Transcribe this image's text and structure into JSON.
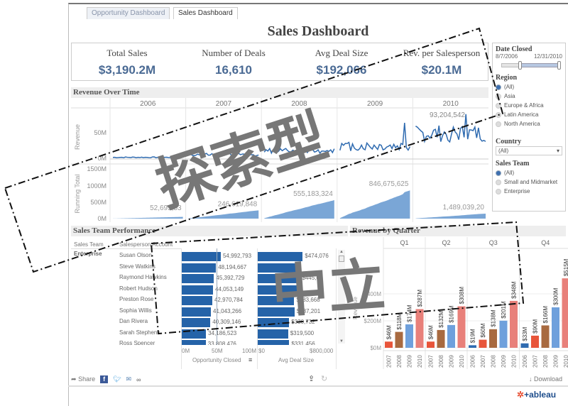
{
  "tabs": [
    {
      "label": "Opportunity Dashboard",
      "active": false
    },
    {
      "label": "Sales Dashboard",
      "active": true
    }
  ],
  "title": "Sales Dashboard",
  "kpis": [
    {
      "label": "Total Sales",
      "value": "$3,190.2M"
    },
    {
      "label": "Number of Deals",
      "value": "16,610"
    },
    {
      "label": "Avg Deal Size",
      "value": "$192,066"
    },
    {
      "label": "Rev. per Salesperson",
      "value": "$20.1M"
    }
  ],
  "filters": {
    "date_closed": {
      "label": "Date Closed",
      "start": "8/7/2006",
      "end": "12/31/2010"
    },
    "region": {
      "label": "Region",
      "options": [
        "(All)",
        "Asia",
        "Europe & Africa",
        "Latin America",
        "North America"
      ],
      "selected": "(All)"
    },
    "country": {
      "label": "Country",
      "value": "(All)"
    },
    "sales_team": {
      "label": "Sales Team",
      "options": [
        "(All)",
        "Small and Midmarket",
        "Enterprise"
      ],
      "selected": "(All)"
    }
  },
  "revenue_over_time": {
    "title": "Revenue Over Time",
    "years": [
      "2006",
      "2007",
      "2008",
      "2009",
      "2010"
    ],
    "revenue_axis_label": "Revenue",
    "revenue_ticks": [
      "50M",
      "0M"
    ],
    "running_axis_label": "Running Total",
    "running_ticks": [
      "1500M",
      "1000M",
      "500M",
      "0M"
    ],
    "peak_label": "93,204,542",
    "running_labels": [
      "52,695,53",
      "246,619,848",
      "555,183,324",
      "846,675,625",
      "1,489,039,20"
    ]
  },
  "sales_team_performance": {
    "title": "Sales Team Performance",
    "col_team": "Sales Team",
    "col_person": "Salesperson Account",
    "team": "Enterprise",
    "rows": [
      {
        "name": "Susan Olson",
        "opp": 54992793,
        "opp_label": "54,992,793",
        "avg": 474076,
        "avg_label": "$474,076"
      },
      {
        "name": "Steve Watkins",
        "opp": 48194667,
        "opp_label": "48,194,667",
        "avg": 450000,
        "avg_label": ""
      },
      {
        "name": "Raymond Hawkins",
        "opp": 45392729,
        "opp_label": "45,392,729",
        "avg": 445020,
        "avg_label": "$445,02"
      },
      {
        "name": "Robert Hudson",
        "opp": 44053149,
        "opp_label": "44,053,149",
        "avg": 430000,
        "avg_label": ""
      },
      {
        "name": "Preston Rose",
        "opp": 42970784,
        "opp_label": "42,970,784",
        "avg": 383668,
        "avg_label": "$383,668"
      },
      {
        "name": "Sophia Willis",
        "opp": 41043266,
        "opp_label": "41,043,266",
        "avg": 387201,
        "avg_label": "$387,201"
      },
      {
        "name": "Dan Rivera",
        "opp": 40309146,
        "opp_label": "40,309,146",
        "avg": 330732,
        "avg_label": "$330,732"
      },
      {
        "name": "Sarah Stephens",
        "opp": 34186523,
        "opp_label": "34,186,523",
        "avg": 319500,
        "avg_label": "$319,500"
      },
      {
        "name": "Ross Spencer",
        "opp": 33808476,
        "opp_label": "33,808,476",
        "avg": 331456,
        "avg_label": "$331,456"
      }
    ],
    "opp_axis": {
      "label": "Opportunity Closed",
      "ticks": [
        "0M",
        "50M",
        "100M"
      ],
      "max": 100000000
    },
    "avg_axis": {
      "label": "Avg Deal Size",
      "ticks": [
        "$0",
        "$800,000"
      ],
      "max": 800000
    }
  },
  "chart_data": {
    "type": "bar",
    "title": "Revenue by Quarter",
    "ylabel": "Revenue",
    "yticks": [
      "$0M",
      "$200M",
      "$400M"
    ],
    "ylim": [
      0,
      560
    ],
    "year_colors": {
      "2006": "#2f6bb0",
      "2007": "#e8553a",
      "2008": "#a86a40",
      "2009": "#6fa0dc",
      "2010": "#e8807a"
    },
    "quarters": [
      {
        "q": "Q1",
        "bars": [
          {
            "year": "2007",
            "value": 46,
            "label": "$46M"
          },
          {
            "year": "2008",
            "value": 118,
            "label": "$118M"
          },
          {
            "year": "2009",
            "value": 174,
            "label": "$174M"
          },
          {
            "year": "2010",
            "value": 287,
            "label": "$287M"
          }
        ]
      },
      {
        "q": "Q2",
        "bars": [
          {
            "year": "2007",
            "value": 46,
            "label": "$46M"
          },
          {
            "year": "2008",
            "value": 132,
            "label": "$132M"
          },
          {
            "year": "2009",
            "value": 169,
            "label": "$169M"
          },
          {
            "year": "2010",
            "value": 308,
            "label": "$308M"
          }
        ]
      },
      {
        "q": "Q3",
        "bars": [
          {
            "year": "2006",
            "value": 19,
            "label": "$19M"
          },
          {
            "year": "2007",
            "value": 60,
            "label": "$60M"
          },
          {
            "year": "2008",
            "value": 138,
            "label": "$138M"
          },
          {
            "year": "2009",
            "value": 201,
            "label": "$201M"
          },
          {
            "year": "2010",
            "value": 348,
            "label": "$348M"
          }
        ]
      },
      {
        "q": "Q4",
        "bars": [
          {
            "year": "2006",
            "value": 33,
            "label": "$33M"
          },
          {
            "year": "2007",
            "value": 90,
            "label": "$90M"
          },
          {
            "year": "2008",
            "value": 166,
            "label": "$166M"
          },
          {
            "year": "2009",
            "value": 300,
            "label": "$300M"
          },
          {
            "year": "2010",
            "value": 515,
            "label": "$515M"
          }
        ]
      }
    ]
  },
  "toolbar": {
    "share": "Share",
    "download": "Download"
  },
  "brand": "+ableau",
  "watermark": {
    "text1": "探索型",
    "text2": "中立",
    "color": "#777777"
  }
}
